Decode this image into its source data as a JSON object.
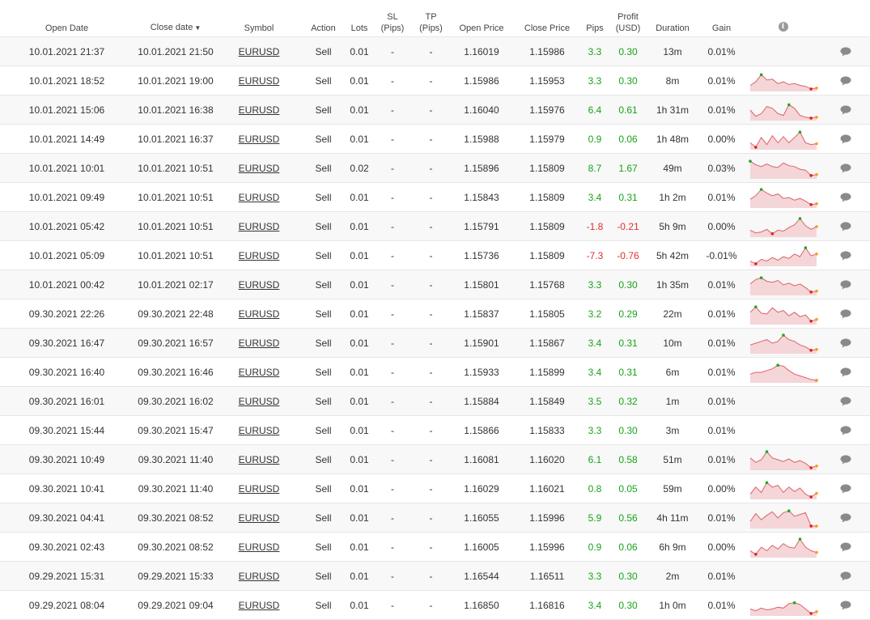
{
  "columns": {
    "open_date": "Open Date",
    "close_date": "Close date",
    "sort_arrow": "▼",
    "symbol": "Symbol",
    "action": "Action",
    "lots": "Lots",
    "sl_line1": "SL",
    "sl_line2": "(Pips)",
    "tp_line1": "TP",
    "tp_line2": "(Pips)",
    "open_price": "Open Price",
    "close_price": "Close Price",
    "pips": "Pips",
    "profit_line1": "Profit",
    "profit_line2": "(USD)",
    "duration": "Duration",
    "gain": "Gain",
    "info_icon": "info-icon"
  },
  "colors": {
    "positive": "#1aa31a",
    "negative": "#e03030",
    "spark_fill": "#f4d6d8",
    "spark_line": "#e06068",
    "spark_max": "#22aa22",
    "spark_min": "#e02020",
    "spark_end": "#ff9922"
  },
  "trades": [
    {
      "open": "10.01.2021 21:37",
      "close": "10.01.2021 21:50",
      "symbol": "EURUSD",
      "action": "Sell",
      "lots": "0.01",
      "sl": "-",
      "tp": "-",
      "open_price": "1.16019",
      "close_price": "1.15986",
      "pips": "3.3",
      "profit": "0.30",
      "duration": "13m",
      "gain": "0.01%",
      "spark": []
    },
    {
      "open": "10.01.2021 18:52",
      "close": "10.01.2021 19:00",
      "symbol": "EURUSD",
      "action": "Sell",
      "lots": "0.01",
      "sl": "-",
      "tp": "-",
      "open_price": "1.15986",
      "close_price": "1.15953",
      "pips": "3.3",
      "profit": "0.30",
      "duration": "8m",
      "gain": "0.01%",
      "spark": [
        0.25,
        0.45,
        0.85,
        0.55,
        0.6,
        0.35,
        0.45,
        0.3,
        0.35,
        0.25,
        0.2,
        0.05,
        0.1
      ]
    },
    {
      "open": "10.01.2021 15:06",
      "close": "10.01.2021 16:38",
      "symbol": "EURUSD",
      "action": "Sell",
      "lots": "0.01",
      "sl": "-",
      "tp": "-",
      "open_price": "1.16040",
      "close_price": "1.15976",
      "pips": "6.4",
      "profit": "0.61",
      "duration": "1h 31m",
      "gain": "0.01%",
      "spark": [
        0.5,
        0.15,
        0.3,
        0.7,
        0.6,
        0.3,
        0.2,
        0.8,
        0.6,
        0.2,
        0.1,
        0.05,
        0.1
      ]
    },
    {
      "open": "10.01.2021 14:49",
      "close": "10.01.2021 16:37",
      "symbol": "EURUSD",
      "action": "Sell",
      "lots": "0.01",
      "sl": "-",
      "tp": "-",
      "open_price": "1.15988",
      "close_price": "1.15979",
      "pips": "0.9",
      "profit": "0.06",
      "duration": "1h 48m",
      "gain": "0.00%",
      "spark": [
        0.3,
        0.05,
        0.6,
        0.2,
        0.7,
        0.3,
        0.65,
        0.3,
        0.6,
        0.9,
        0.3,
        0.2,
        0.25
      ]
    },
    {
      "open": "10.01.2021 10:01",
      "close": "10.01.2021 10:51",
      "symbol": "EURUSD",
      "action": "Sell",
      "lots": "0.02",
      "sl": "-",
      "tp": "-",
      "open_price": "1.15896",
      "close_price": "1.15809",
      "pips": "8.7",
      "profit": "1.67",
      "duration": "49m",
      "gain": "0.03%",
      "spark": [
        0.9,
        0.7,
        0.6,
        0.75,
        0.6,
        0.55,
        0.8,
        0.65,
        0.6,
        0.45,
        0.4,
        0.1,
        0.15
      ]
    },
    {
      "open": "10.01.2021 09:49",
      "close": "10.01.2021 10:51",
      "symbol": "EURUSD",
      "action": "Sell",
      "lots": "0.01",
      "sl": "-",
      "tp": "-",
      "open_price": "1.15843",
      "close_price": "1.15809",
      "pips": "3.4",
      "profit": "0.31",
      "duration": "1h 2m",
      "gain": "0.01%",
      "spark": [
        0.4,
        0.6,
        0.95,
        0.75,
        0.6,
        0.7,
        0.45,
        0.5,
        0.35,
        0.45,
        0.3,
        0.1,
        0.15
      ]
    },
    {
      "open": "10.01.2021 05:42",
      "close": "10.01.2021 10:51",
      "symbol": "EURUSD",
      "action": "Sell",
      "lots": "0.01",
      "sl": "-",
      "tp": "-",
      "open_price": "1.15791",
      "close_price": "1.15809",
      "pips": "-1.8",
      "profit": "-0.21",
      "duration": "5h 9m",
      "gain": "0.00%",
      "spark": [
        0.3,
        0.15,
        0.2,
        0.35,
        0.1,
        0.3,
        0.25,
        0.45,
        0.6,
        0.95,
        0.55,
        0.35,
        0.5
      ]
    },
    {
      "open": "10.01.2021 05:09",
      "close": "10.01.2021 10:51",
      "symbol": "EURUSD",
      "action": "Sell",
      "lots": "0.01",
      "sl": "-",
      "tp": "-",
      "open_price": "1.15736",
      "close_price": "1.15809",
      "pips": "-7.3",
      "profit": "-0.76",
      "duration": "5h 42m",
      "gain": "-0.01%",
      "spark": [
        0.2,
        0.05,
        0.3,
        0.2,
        0.4,
        0.25,
        0.45,
        0.35,
        0.6,
        0.45,
        0.95,
        0.5,
        0.6
      ]
    },
    {
      "open": "10.01.2021 00:42",
      "close": "10.01.2021 02:17",
      "symbol": "EURUSD",
      "action": "Sell",
      "lots": "0.01",
      "sl": "-",
      "tp": "-",
      "open_price": "1.15801",
      "close_price": "1.15768",
      "pips": "3.3",
      "profit": "0.30",
      "duration": "1h 35m",
      "gain": "0.01%",
      "spark": [
        0.55,
        0.8,
        0.9,
        0.7,
        0.65,
        0.75,
        0.5,
        0.6,
        0.45,
        0.55,
        0.35,
        0.1,
        0.15
      ]
    },
    {
      "open": "09.30.2021 22:26",
      "close": "09.30.2021 22:48",
      "symbol": "EURUSD",
      "action": "Sell",
      "lots": "0.01",
      "sl": "-",
      "tp": "-",
      "open_price": "1.15837",
      "close_price": "1.15805",
      "pips": "3.2",
      "profit": "0.29",
      "duration": "22m",
      "gain": "0.01%",
      "spark": [
        0.6,
        0.9,
        0.55,
        0.5,
        0.85,
        0.6,
        0.7,
        0.4,
        0.6,
        0.35,
        0.45,
        0.1,
        0.2
      ]
    },
    {
      "open": "09.30.2021 16:47",
      "close": "09.30.2021 16:57",
      "symbol": "EURUSD",
      "action": "Sell",
      "lots": "0.01",
      "sl": "-",
      "tp": "-",
      "open_price": "1.15901",
      "close_price": "1.15867",
      "pips": "3.4",
      "profit": "0.31",
      "duration": "10m",
      "gain": "0.01%",
      "spark": [
        0.4,
        0.5,
        0.6,
        0.7,
        0.5,
        0.6,
        0.95,
        0.7,
        0.6,
        0.4,
        0.3,
        0.1,
        0.15
      ]
    },
    {
      "open": "09.30.2021 16:40",
      "close": "09.30.2021 16:46",
      "symbol": "EURUSD",
      "action": "Sell",
      "lots": "0.01",
      "sl": "-",
      "tp": "-",
      "open_price": "1.15933",
      "close_price": "1.15899",
      "pips": "3.4",
      "profit": "0.31",
      "duration": "6m",
      "gain": "0.01%",
      "spark": [
        0.4,
        0.5,
        0.5,
        0.6,
        0.7,
        0.9,
        0.85,
        0.6,
        0.4,
        0.3,
        0.2,
        0.1,
        0.05
      ]
    },
    {
      "open": "09.30.2021 16:01",
      "close": "09.30.2021 16:02",
      "symbol": "EURUSD",
      "action": "Sell",
      "lots": "0.01",
      "sl": "-",
      "tp": "-",
      "open_price": "1.15884",
      "close_price": "1.15849",
      "pips": "3.5",
      "profit": "0.32",
      "duration": "1m",
      "gain": "0.01%",
      "spark": []
    },
    {
      "open": "09.30.2021 15:44",
      "close": "09.30.2021 15:47",
      "symbol": "EURUSD",
      "action": "Sell",
      "lots": "0.01",
      "sl": "-",
      "tp": "-",
      "open_price": "1.15866",
      "close_price": "1.15833",
      "pips": "3.3",
      "profit": "0.30",
      "duration": "3m",
      "gain": "0.01%",
      "spark": []
    },
    {
      "open": "09.30.2021 10:49",
      "close": "09.30.2021 11:40",
      "symbol": "EURUSD",
      "action": "Sell",
      "lots": "0.01",
      "sl": "-",
      "tp": "-",
      "open_price": "1.16081",
      "close_price": "1.16020",
      "pips": "6.1",
      "profit": "0.58",
      "duration": "51m",
      "gain": "0.01%",
      "spark": [
        0.6,
        0.35,
        0.5,
        0.95,
        0.6,
        0.5,
        0.4,
        0.55,
        0.35,
        0.45,
        0.3,
        0.05,
        0.15
      ]
    },
    {
      "open": "09.30.2021 10:41",
      "close": "09.30.2021 11:40",
      "symbol": "EURUSD",
      "action": "Sell",
      "lots": "0.01",
      "sl": "-",
      "tp": "-",
      "open_price": "1.16029",
      "close_price": "1.16021",
      "pips": "0.8",
      "profit": "0.05",
      "duration": "59m",
      "gain": "0.00%",
      "spark": [
        0.2,
        0.6,
        0.3,
        0.85,
        0.6,
        0.7,
        0.3,
        0.6,
        0.35,
        0.55,
        0.2,
        0.05,
        0.25
      ]
    },
    {
      "open": "09.30.2021 04:41",
      "close": "09.30.2021 08:52",
      "symbol": "EURUSD",
      "action": "Sell",
      "lots": "0.01",
      "sl": "-",
      "tp": "-",
      "open_price": "1.16055",
      "close_price": "1.15996",
      "pips": "5.9",
      "profit": "0.56",
      "duration": "4h 11m",
      "gain": "0.01%",
      "spark": [
        0.3,
        0.75,
        0.4,
        0.65,
        0.85,
        0.5,
        0.8,
        0.9,
        0.6,
        0.7,
        0.8,
        0.05,
        0.05
      ]
    },
    {
      "open": "09.30.2021 02:43",
      "close": "09.30.2021 08:52",
      "symbol": "EURUSD",
      "action": "Sell",
      "lots": "0.01",
      "sl": "-",
      "tp": "-",
      "open_price": "1.16005",
      "close_price": "1.15996",
      "pips": "0.9",
      "profit": "0.06",
      "duration": "6h 9m",
      "gain": "0.00%",
      "spark": [
        0.3,
        0.1,
        0.5,
        0.3,
        0.6,
        0.4,
        0.7,
        0.5,
        0.45,
        0.95,
        0.5,
        0.3,
        0.2
      ]
    },
    {
      "open": "09.29.2021 15:31",
      "close": "09.29.2021 15:33",
      "symbol": "EURUSD",
      "action": "Sell",
      "lots": "0.01",
      "sl": "-",
      "tp": "-",
      "open_price": "1.16544",
      "close_price": "1.16511",
      "pips": "3.3",
      "profit": "0.30",
      "duration": "2m",
      "gain": "0.01%",
      "spark": []
    },
    {
      "open": "09.29.2021 08:04",
      "close": "09.29.2021 09:04",
      "symbol": "EURUSD",
      "action": "Sell",
      "lots": "0.01",
      "sl": "-",
      "tp": "-",
      "open_price": "1.16850",
      "close_price": "1.16816",
      "pips": "3.4",
      "profit": "0.30",
      "duration": "1h 0m",
      "gain": "0.01%",
      "spark": [
        0.3,
        0.2,
        0.35,
        0.25,
        0.3,
        0.4,
        0.35,
        0.6,
        0.65,
        0.55,
        0.3,
        0.05,
        0.15
      ]
    }
  ]
}
